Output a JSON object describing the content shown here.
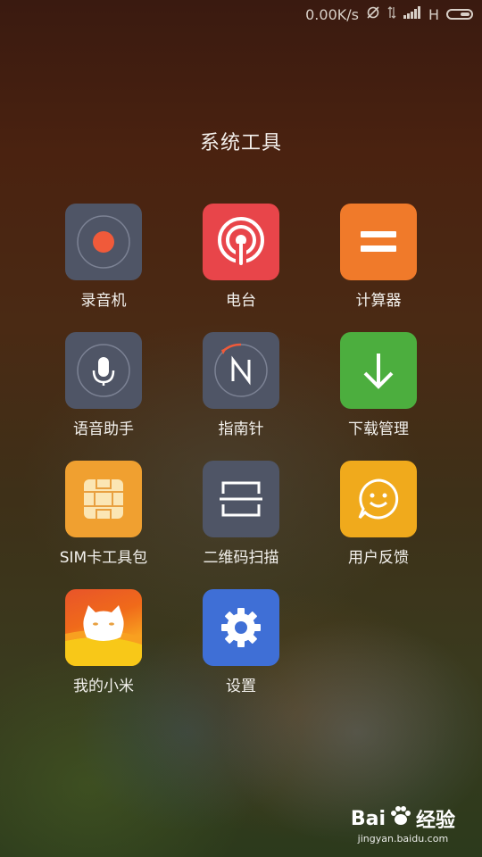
{
  "status_bar": {
    "speed": "0.00K/s",
    "network_type": "H",
    "icons": [
      "sync-off-icon",
      "data-arrows-icon",
      "signal-icon",
      "battery-icon"
    ]
  },
  "folder": {
    "title": "系统工具",
    "apps": [
      {
        "label": "录音机",
        "icon": "recorder-icon",
        "color": "#4f5566"
      },
      {
        "label": "电台",
        "icon": "radio-icon",
        "color": "#e8454a"
      },
      {
        "label": "计算器",
        "icon": "calculator-icon",
        "color": "#f07a2a"
      },
      {
        "label": "语音助手",
        "icon": "microphone-icon",
        "color": "#4f5566"
      },
      {
        "label": "指南针",
        "icon": "compass-icon",
        "color": "#4f5566"
      },
      {
        "label": "下载管理",
        "icon": "download-icon",
        "color": "#4cae3e"
      },
      {
        "label": "SIM卡工具包",
        "icon": "sim-card-icon",
        "color": "#f0a030"
      },
      {
        "label": "二维码扫描",
        "icon": "qr-scan-icon",
        "color": "#4f5566"
      },
      {
        "label": "用户反馈",
        "icon": "feedback-icon",
        "color": "#f0aa1c"
      },
      {
        "label": "我的小米",
        "icon": "mi-bunny-icon",
        "color": "#f06a1a"
      },
      {
        "label": "设置",
        "icon": "settings-gear-icon",
        "color": "#3f6fd6"
      }
    ]
  },
  "watermark": {
    "brand": "Bai",
    "brand_suffix": "经验",
    "url": "jingyan.baidu.com"
  }
}
